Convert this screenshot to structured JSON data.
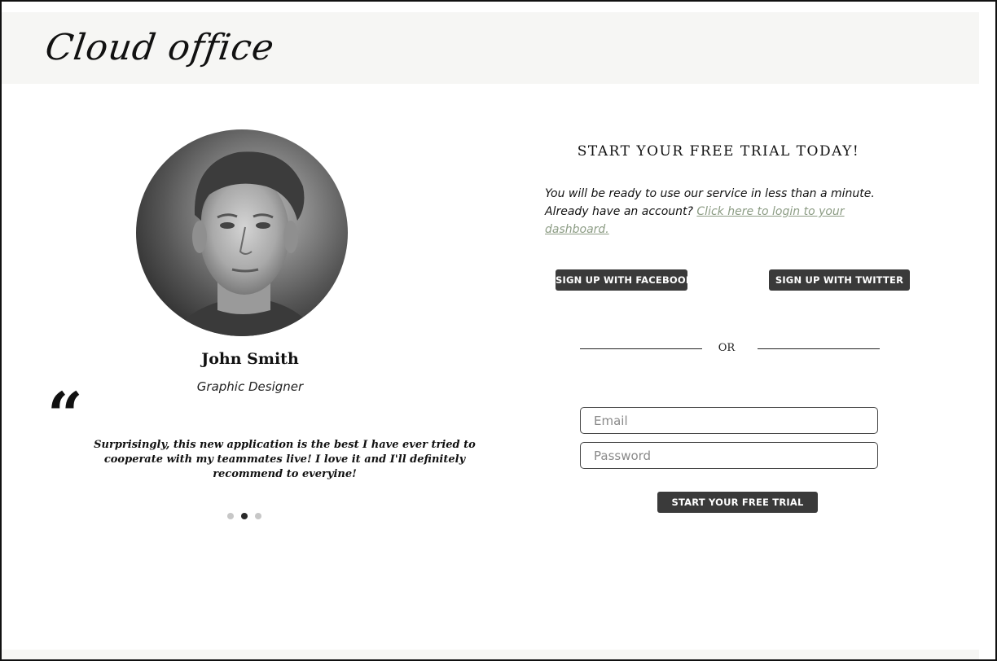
{
  "header": {
    "logo_text": "Cloud office"
  },
  "testimonial": {
    "name": "John Smith",
    "role": "Graphic Designer",
    "quote_mark": "“",
    "quote": "Surprisingly, this new application is the best I have ever tried to cooperate with my teammates live! I love it and I'll definitely recommend to everyine!",
    "slides": [
      {
        "active": false
      },
      {
        "active": true
      },
      {
        "active": false
      }
    ]
  },
  "signup": {
    "heading": "START YOUR FREE TRIAL TODAY!",
    "intro_text": "You will be ready to use our service in less than a minute. Already have an account? ",
    "login_link": "Click here to login to your dashboard.",
    "facebook_button": "SIGN UP WITH FACEBOOK",
    "twitter_button": "SIGN UP WITH TWITTER",
    "divider_text": "OR",
    "email_placeholder": "Email",
    "password_placeholder": "Password",
    "submit_button": "START YOUR FREE TRIAL"
  },
  "colors": {
    "header_bg": "#f6f6f4",
    "button_bg": "#3a3a3a",
    "link": "#8c9c84",
    "dot_active": "#2a2a2a",
    "dot_inactive": "#c7c7c7"
  }
}
